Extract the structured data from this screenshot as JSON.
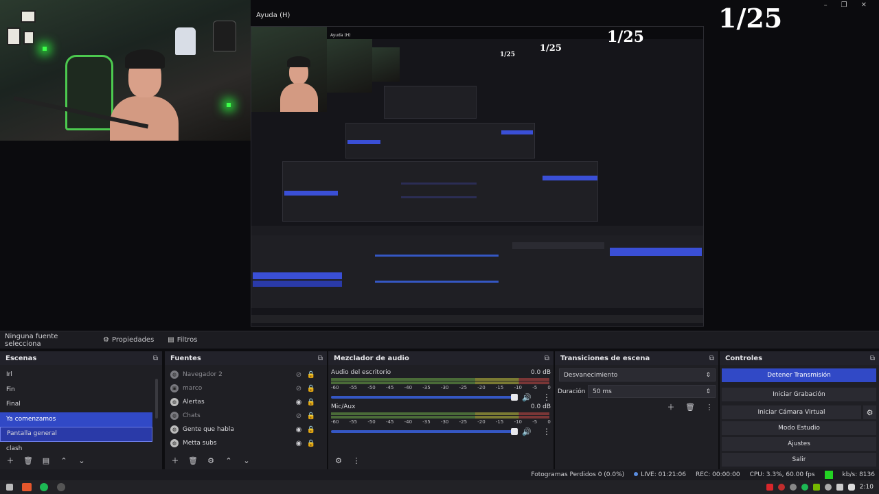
{
  "preview": {
    "title": "Ayuda (H)",
    "counter": "1/25",
    "nested_title": "Ayuda (H)",
    "nested_counter_1": "1/25",
    "nested_counter_2": "1/25",
    "nested_counter_3": "1/25",
    "window_controls": {
      "minimize": "–",
      "restore": "❐",
      "close": "✕"
    }
  },
  "dockbar": {
    "no_selection": "Ninguna fuente selecciona",
    "properties": "Propiedades",
    "filters": "Filtros"
  },
  "scenes": {
    "title": "Escenas",
    "items": [
      {
        "label": "Irl"
      },
      {
        "label": "Fin"
      },
      {
        "label": "Final"
      },
      {
        "label": "Ya comenzamos"
      },
      {
        "label": "Pantalla general"
      },
      {
        "label": "clash"
      }
    ]
  },
  "sources": {
    "title": "Fuentes",
    "items": [
      {
        "label": "Navegador 2"
      },
      {
        "label": "marco"
      },
      {
        "label": "Alertas"
      },
      {
        "label": "Chats"
      },
      {
        "label": "Gente que habla"
      },
      {
        "label": "Metta subs"
      }
    ]
  },
  "mixer": {
    "title": "Mezclador de audio",
    "channels": [
      {
        "name": "Audio del escritorio",
        "level": "0.0 dB"
      },
      {
        "name": "Mic/Aux",
        "level": "0.0 dB"
      }
    ],
    "scale": [
      "-60",
      "-55",
      "-50",
      "-45",
      "-40",
      "-35",
      "-30",
      "-25",
      "-20",
      "-15",
      "-10",
      "-5",
      "0"
    ]
  },
  "transitions": {
    "title": "Transiciones de escena",
    "selected": "Desvanecimiento",
    "duration_label": "Duración",
    "duration_value": "50 ms"
  },
  "controls": {
    "title": "Controles",
    "stop_stream": "Detener Transmisión",
    "start_recording": "Iniciar Grabación",
    "virtual_cam": "Iniciar Cámara Virtual",
    "studio_mode": "Modo Estudio",
    "settings": "Ajustes",
    "exit": "Salir"
  },
  "status": {
    "dropped_frames": "Fotogramas Perdidos 0 (0.0%)",
    "live": "LIVE: 01:21:06",
    "rec": "REC: 00:00:00",
    "cpu": "CPU: 3.3%, 60.00 fps",
    "bitrate": "kb/s: 8136"
  },
  "taskbar": {
    "clock": "2:10"
  },
  "colors": {
    "accent": "#3149c6",
    "status_ok": "#23d323",
    "panel_bg": "#1f1f24"
  }
}
